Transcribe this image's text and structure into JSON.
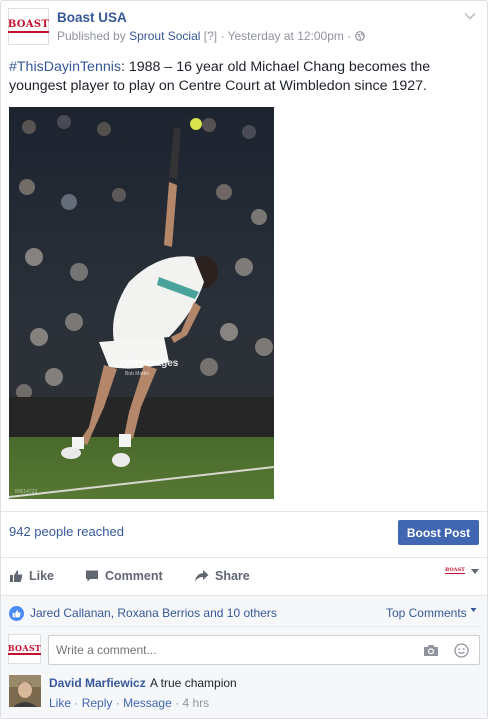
{
  "post": {
    "page_name": "Boast USA",
    "logo_text": "BOAST",
    "published_prefix": "Published by",
    "publisher": "Sprout Social",
    "help_marker": "[?]",
    "separator": "·",
    "timestamp": "Yesterday at 12:00pm",
    "hashtag": "#ThisDayinTennis",
    "text": ": 1988 – 16 year old Michael Chang becomes the youngest player to play on Centre Court at Wimbledon since 1927.",
    "image_watermark": "gettyimages",
    "image_credit": "Bob Martin",
    "image_id": "80614723"
  },
  "insights": {
    "reached": "942 people reached",
    "boost_label": "Boost Post"
  },
  "actions": {
    "like": "Like",
    "comment": "Comment",
    "share": "Share"
  },
  "reactions": {
    "likers": "Jared Callanan, Roxana Berrios and 10 others",
    "sort_label": "Top Comments"
  },
  "comment_box": {
    "placeholder": "Write a comment..."
  },
  "comments": [
    {
      "author": "David Marfiewicz",
      "text": "A true champion",
      "like": "Like",
      "reply": "Reply",
      "message": "Message",
      "time": "4 hrs"
    }
  ],
  "colors": {
    "link": "#365899",
    "boost_button": "#4267b2",
    "brand_red": "#c8102e"
  }
}
